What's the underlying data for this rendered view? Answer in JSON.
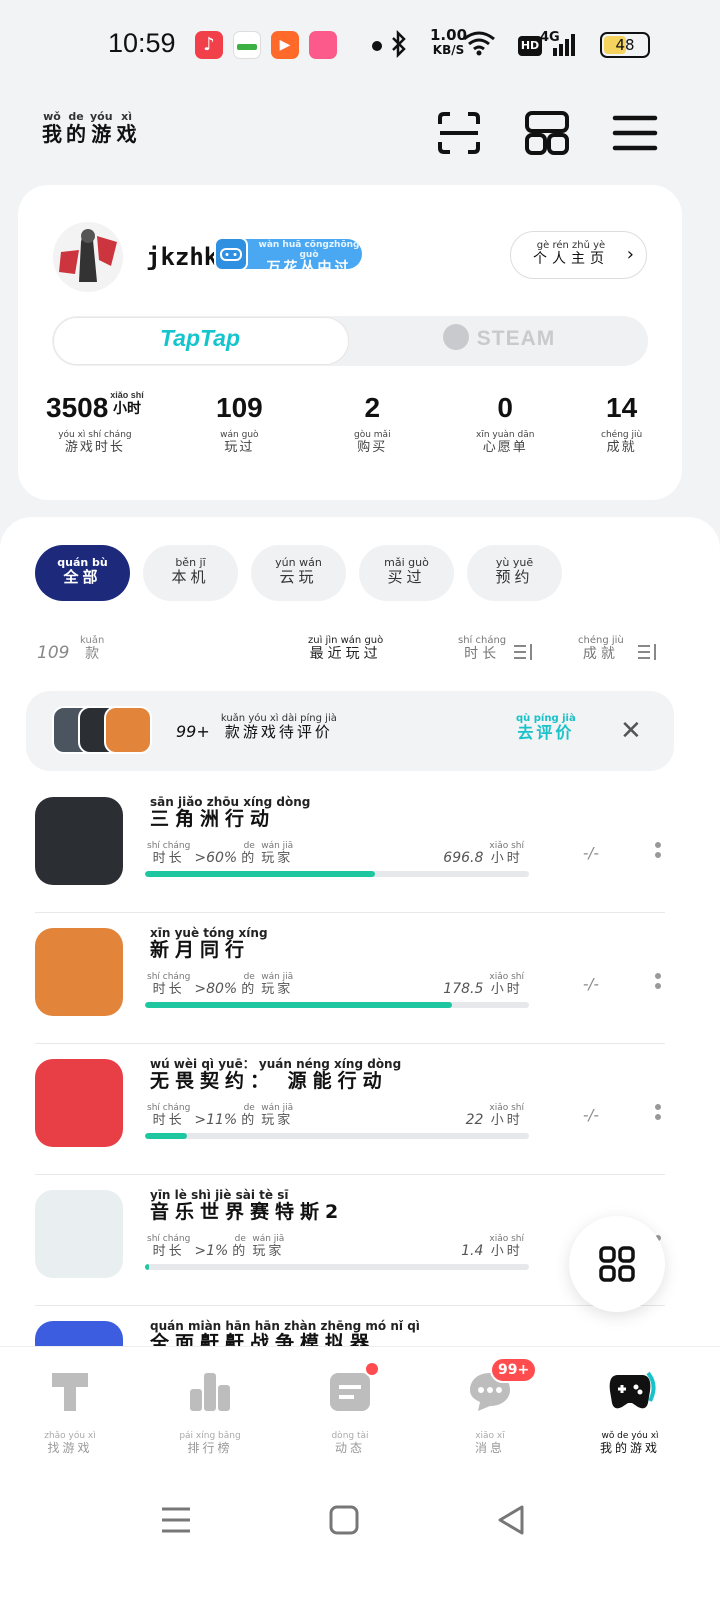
{
  "status_bar": {
    "time": "10:59",
    "net_speed_value": "1.00",
    "net_speed_unit": "KB/S",
    "hd": "HD",
    "network": "4G",
    "battery": "48"
  },
  "header": {
    "title": [
      {
        "py": "wǒ",
        "han": "我"
      },
      {
        "py": "de",
        "han": "的"
      },
      {
        "py": "yóu",
        "han": "游"
      },
      {
        "py": "xì",
        "han": "戏"
      }
    ],
    "icons": [
      "scan-icon",
      "grid-apps-icon",
      "menu-icon"
    ]
  },
  "profile": {
    "username": "jkzhk",
    "badge": {
      "py": "wàn huā cōngzhōng guò",
      "han": "万花丛中过"
    },
    "homepage_btn": {
      "py": "gè rén zhǔ yè",
      "han": "个人主页"
    },
    "platform_tabs": [
      "TapTap",
      "STEAM"
    ],
    "active_platform": "TapTap",
    "stats": [
      {
        "value": "3508",
        "unit_py": "xiǎo shí",
        "unit_han": "小时",
        "label_py": "yóu xì shí cháng",
        "label_han": "游戏时长"
      },
      {
        "value": "109",
        "unit_py": "",
        "unit_han": "",
        "label_py": "wán guò",
        "label_han": "玩过"
      },
      {
        "value": "2",
        "unit_py": "",
        "unit_han": "",
        "label_py": "gòu mǎi",
        "label_han": "购买"
      },
      {
        "value": "0",
        "unit_py": "",
        "unit_han": "",
        "label_py": "xīn yuàn dān",
        "label_han": "心愿单"
      },
      {
        "value": "14",
        "unit_py": "",
        "unit_han": "",
        "label_py": "chéng jiù",
        "label_han": "成就"
      }
    ]
  },
  "filters": [
    {
      "py": "quán bù",
      "han": "全部",
      "active": true
    },
    {
      "py": "běn jī",
      "han": "本机",
      "active": false
    },
    {
      "py": "yún wán",
      "han": "云玩",
      "active": false
    },
    {
      "py": "mǎi guò",
      "han": "买过",
      "active": false
    },
    {
      "py": "yù yuē",
      "han": "预约",
      "active": false
    }
  ],
  "sort_bar": {
    "count": "109",
    "count_unit_py": "kuǎn",
    "count_unit_han": "款",
    "recent": {
      "py": "zuì jìn wán guò",
      "han": "最近玩过"
    },
    "duration": {
      "py": "shí cháng",
      "han": "时长"
    },
    "achievements": {
      "py": "chéng jiù",
      "han": "成就"
    }
  },
  "review_banner": {
    "count": "99+",
    "text_py": "kuǎn yóu xì dài píng jià",
    "text_han": "款游戏待评价",
    "cta_py": "qù píng jià",
    "cta_han": "去评价"
  },
  "games": [
    {
      "name_py": "sān jiǎo zhōu xíng dòng",
      "name_han": "三角洲行动",
      "pct": ">60%",
      "hours": "696.8",
      "progress": 0.6,
      "rating": "-/-",
      "color": "#2b2f33"
    },
    {
      "name_py": "xīn yuè tóng xíng",
      "name_han": "新月同行",
      "pct": ">80%",
      "hours": "178.5",
      "progress": 0.8,
      "rating": "-/-",
      "color": "#e2843a"
    },
    {
      "name_py": "wú wèi qì yuē： yuán néng xíng dòng",
      "name_han": "无畏契约： 源能行动",
      "pct": ">11%",
      "hours": "22",
      "progress": 0.11,
      "rating": "-/-",
      "color": "#e83e46"
    },
    {
      "name_py": "yīn lè shì jiè sài tè sī",
      "name_han": "音乐世界赛特斯2",
      "pct": ">1%",
      "hours": "1.4",
      "progress": 0.01,
      "rating": "",
      "color": "#e9eef0"
    },
    {
      "name_py": "quán miàn hān hān zhàn zhēng mó nǐ qì",
      "name_han": "全面鼾鼾战争模拟器",
      "pct": "",
      "hours": "",
      "progress": 0,
      "rating": "",
      "color": "#3c5de0"
    }
  ],
  "meta_labels": {
    "duration_py": "shí cháng",
    "duration_han": "时长",
    "of_py": "de",
    "of_han": "的",
    "players_py": "wán jiā",
    "players_han": "玩家",
    "hours_py": "xiǎo shí",
    "hours_han": "小时"
  },
  "bottom_nav": [
    {
      "py": "zhǎo yóu xì",
      "han": "找游戏",
      "icon": "taptap-icon",
      "active": false
    },
    {
      "py": "pái xíng bǎng",
      "han": "排行榜",
      "icon": "ranking-icon",
      "active": false
    },
    {
      "py": "dòng tài",
      "han": "动态",
      "icon": "feed-icon",
      "active": false
    },
    {
      "py": "xiāo xī",
      "han": "消息",
      "icon": "message-icon",
      "active": false,
      "badge": "99+"
    },
    {
      "py": "wǒ de yóu xì",
      "han": "我的游戏",
      "icon": "gamepad-icon",
      "active": true
    }
  ],
  "colors": {
    "accent": "#15c5ce",
    "chip_active": "#1d2a7c",
    "progress": "#1ec7a0",
    "badge_red": "#ff4d4f"
  }
}
